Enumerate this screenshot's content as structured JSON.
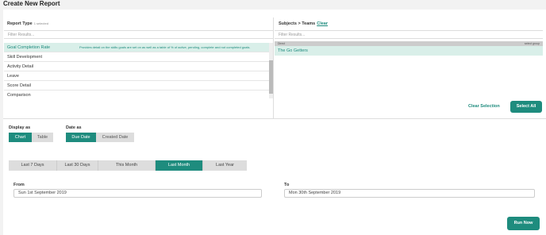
{
  "page": {
    "title": "Create New Report"
  },
  "report_type": {
    "heading": "Report Type",
    "selected_count": "1 selected",
    "filter_placeholder": "Filter Results...",
    "items": [
      {
        "label": "Goal Completion Rate",
        "description": "Provides detail on the skills goals are set on as well as a table of % of active, pending, complete and not completed goals.",
        "selected": true
      },
      {
        "label": "Skill Development",
        "selected": false
      },
      {
        "label": "Activity Detail",
        "selected": false
      },
      {
        "label": "Leave",
        "selected": false
      },
      {
        "label": "Score Detail",
        "selected": false
      },
      {
        "label": "Comparison",
        "selected": false
      }
    ]
  },
  "subjects": {
    "heading": "Subjects > Teams",
    "clear_label": "Clear",
    "filter_placeholder": "Filter Results...",
    "direct_label": "Direct",
    "select_group_label": "select group",
    "teams": [
      "The Go Getters"
    ],
    "clear_selection_label": "Clear Selection",
    "select_all_label": "Select All"
  },
  "display_as": {
    "label": "Display as",
    "options": [
      "Chart",
      "Table"
    ],
    "selected": "Chart"
  },
  "date_as": {
    "label": "Date as",
    "options": [
      "Due Date",
      "Created Date"
    ],
    "selected": "Due Date"
  },
  "date_ranges": {
    "options": [
      "Last 7 Days",
      "Last 30 Days",
      "This Month",
      "Last Month",
      "Last Year"
    ],
    "selected": "Last Month"
  },
  "from": {
    "label": "From",
    "value": "Sun 1st September 2019"
  },
  "to": {
    "label": "To",
    "value": "Mon 30th September 2019"
  },
  "run_now_label": "Run Now",
  "colors": {
    "accent": "#1e8c7e",
    "selected_row": "#d9efe9"
  }
}
